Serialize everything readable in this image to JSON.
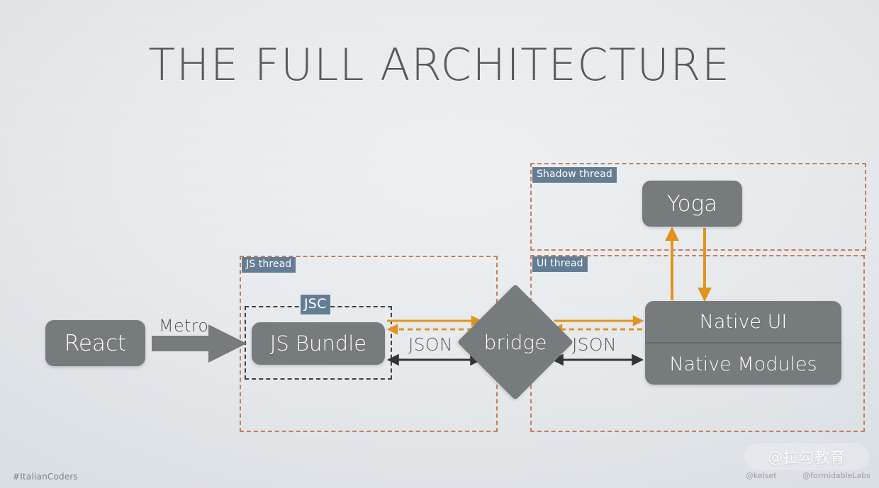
{
  "slide": {
    "title": "THE FULL ARCHITECTURE",
    "background_color": "#e8ebee",
    "accent_orange": "#e1941f",
    "region_border_color": "#c97d5d",
    "node_fill_color": "#767b7d",
    "badge_color": "#647d94",
    "text_color": "#565b5e"
  },
  "regions": [
    {
      "id": "js-thread",
      "label": "JS thread"
    },
    {
      "id": "shadow-thread",
      "label": "Shadow thread"
    },
    {
      "id": "ui-thread",
      "label": "UI thread"
    }
  ],
  "groups": [
    {
      "id": "jsc",
      "label": "JSC"
    }
  ],
  "nodes": {
    "react": "React",
    "js_bundle": "JS Bundle",
    "bridge": "bridge",
    "yoga": "Yoga",
    "native_ui": "Native UI",
    "native_modules": "Native Modules"
  },
  "edges": {
    "metro": "Metro",
    "json_left": "JSON",
    "json_right": "JSON"
  },
  "footer": {
    "hashtag": "#ItalianCoders",
    "watermark": "@拉勾教育",
    "handle_left": "@kelset",
    "handle_right": "@formidableLabs"
  }
}
